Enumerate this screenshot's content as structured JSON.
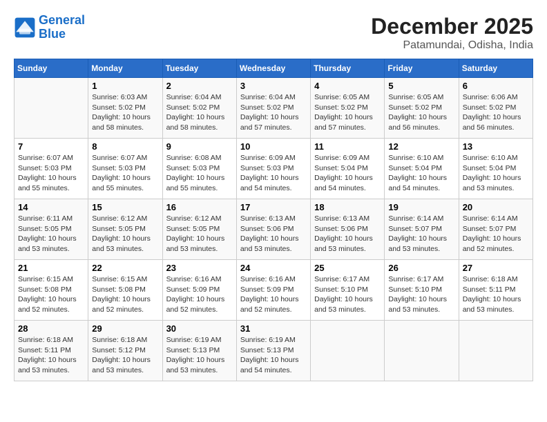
{
  "header": {
    "logo_line1": "General",
    "logo_line2": "Blue",
    "month": "December 2025",
    "location": "Patamundai, Odisha, India"
  },
  "days_of_week": [
    "Sunday",
    "Monday",
    "Tuesday",
    "Wednesday",
    "Thursday",
    "Friday",
    "Saturday"
  ],
  "weeks": [
    [
      {
        "day": "",
        "sunrise": "",
        "sunset": "",
        "daylight": ""
      },
      {
        "day": "1",
        "sunrise": "6:03 AM",
        "sunset": "5:02 PM",
        "daylight": "10 hours and 58 minutes."
      },
      {
        "day": "2",
        "sunrise": "6:04 AM",
        "sunset": "5:02 PM",
        "daylight": "10 hours and 58 minutes."
      },
      {
        "day": "3",
        "sunrise": "6:04 AM",
        "sunset": "5:02 PM",
        "daylight": "10 hours and 57 minutes."
      },
      {
        "day": "4",
        "sunrise": "6:05 AM",
        "sunset": "5:02 PM",
        "daylight": "10 hours and 57 minutes."
      },
      {
        "day": "5",
        "sunrise": "6:05 AM",
        "sunset": "5:02 PM",
        "daylight": "10 hours and 56 minutes."
      },
      {
        "day": "6",
        "sunrise": "6:06 AM",
        "sunset": "5:02 PM",
        "daylight": "10 hours and 56 minutes."
      }
    ],
    [
      {
        "day": "7",
        "sunrise": "6:07 AM",
        "sunset": "5:03 PM",
        "daylight": "10 hours and 55 minutes."
      },
      {
        "day": "8",
        "sunrise": "6:07 AM",
        "sunset": "5:03 PM",
        "daylight": "10 hours and 55 minutes."
      },
      {
        "day": "9",
        "sunrise": "6:08 AM",
        "sunset": "5:03 PM",
        "daylight": "10 hours and 55 minutes."
      },
      {
        "day": "10",
        "sunrise": "6:09 AM",
        "sunset": "5:03 PM",
        "daylight": "10 hours and 54 minutes."
      },
      {
        "day": "11",
        "sunrise": "6:09 AM",
        "sunset": "5:04 PM",
        "daylight": "10 hours and 54 minutes."
      },
      {
        "day": "12",
        "sunrise": "6:10 AM",
        "sunset": "5:04 PM",
        "daylight": "10 hours and 54 minutes."
      },
      {
        "day": "13",
        "sunrise": "6:10 AM",
        "sunset": "5:04 PM",
        "daylight": "10 hours and 53 minutes."
      }
    ],
    [
      {
        "day": "14",
        "sunrise": "6:11 AM",
        "sunset": "5:05 PM",
        "daylight": "10 hours and 53 minutes."
      },
      {
        "day": "15",
        "sunrise": "6:12 AM",
        "sunset": "5:05 PM",
        "daylight": "10 hours and 53 minutes."
      },
      {
        "day": "16",
        "sunrise": "6:12 AM",
        "sunset": "5:05 PM",
        "daylight": "10 hours and 53 minutes."
      },
      {
        "day": "17",
        "sunrise": "6:13 AM",
        "sunset": "5:06 PM",
        "daylight": "10 hours and 53 minutes."
      },
      {
        "day": "18",
        "sunrise": "6:13 AM",
        "sunset": "5:06 PM",
        "daylight": "10 hours and 53 minutes."
      },
      {
        "day": "19",
        "sunrise": "6:14 AM",
        "sunset": "5:07 PM",
        "daylight": "10 hours and 53 minutes."
      },
      {
        "day": "20",
        "sunrise": "6:14 AM",
        "sunset": "5:07 PM",
        "daylight": "10 hours and 52 minutes."
      }
    ],
    [
      {
        "day": "21",
        "sunrise": "6:15 AM",
        "sunset": "5:08 PM",
        "daylight": "10 hours and 52 minutes."
      },
      {
        "day": "22",
        "sunrise": "6:15 AM",
        "sunset": "5:08 PM",
        "daylight": "10 hours and 52 minutes."
      },
      {
        "day": "23",
        "sunrise": "6:16 AM",
        "sunset": "5:09 PM",
        "daylight": "10 hours and 52 minutes."
      },
      {
        "day": "24",
        "sunrise": "6:16 AM",
        "sunset": "5:09 PM",
        "daylight": "10 hours and 52 minutes."
      },
      {
        "day": "25",
        "sunrise": "6:17 AM",
        "sunset": "5:10 PM",
        "daylight": "10 hours and 53 minutes."
      },
      {
        "day": "26",
        "sunrise": "6:17 AM",
        "sunset": "5:10 PM",
        "daylight": "10 hours and 53 minutes."
      },
      {
        "day": "27",
        "sunrise": "6:18 AM",
        "sunset": "5:11 PM",
        "daylight": "10 hours and 53 minutes."
      }
    ],
    [
      {
        "day": "28",
        "sunrise": "6:18 AM",
        "sunset": "5:11 PM",
        "daylight": "10 hours and 53 minutes."
      },
      {
        "day": "29",
        "sunrise": "6:18 AM",
        "sunset": "5:12 PM",
        "daylight": "10 hours and 53 minutes."
      },
      {
        "day": "30",
        "sunrise": "6:19 AM",
        "sunset": "5:13 PM",
        "daylight": "10 hours and 53 minutes."
      },
      {
        "day": "31",
        "sunrise": "6:19 AM",
        "sunset": "5:13 PM",
        "daylight": "10 hours and 54 minutes."
      },
      {
        "day": "",
        "sunrise": "",
        "sunset": "",
        "daylight": ""
      },
      {
        "day": "",
        "sunrise": "",
        "sunset": "",
        "daylight": ""
      },
      {
        "day": "",
        "sunrise": "",
        "sunset": "",
        "daylight": ""
      }
    ]
  ],
  "labels": {
    "sunrise_prefix": "Sunrise: ",
    "sunset_prefix": "Sunset: ",
    "daylight_prefix": "Daylight: "
  }
}
